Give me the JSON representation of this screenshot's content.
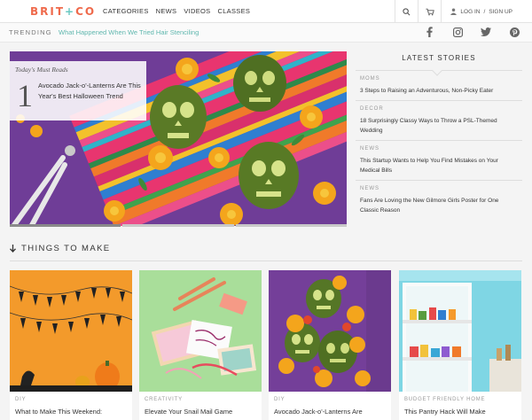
{
  "header": {
    "logo_left": "BRIT",
    "logo_plus": "+",
    "logo_right": "CO",
    "nav": [
      "CATEGORIES",
      "NEWS",
      "VIDEOS",
      "CLASSES"
    ],
    "login": "LOG IN",
    "signup_sep": "/",
    "signup": "SIGN UP"
  },
  "trending": {
    "label": "TRENDING",
    "link": "What Happened When We Tried Hair Stenciling"
  },
  "hero": {
    "tag": "Today's Must Reads",
    "number": "1",
    "title": "Avocado Jack-o'-Lanterns Are This Year's Best Halloween Trend",
    "slides": 3,
    "active_slide": 1
  },
  "latest": {
    "title": "LATEST STORIES",
    "stories": [
      {
        "category": "MOMS",
        "title": "3 Steps to Raising an Adventurous, Non-Picky Eater"
      },
      {
        "category": "DECOR",
        "title": "18 Surprisingly Classy Ways to Throw a PSL-Themed Wedding"
      },
      {
        "category": "NEWS",
        "title": "This Startup Wants to Help You Find Mistakes on Your Medical Bills"
      },
      {
        "category": "NEWS",
        "title": "Fans Are Loving the New Gilmore Girls Poster for One Classic Reason"
      }
    ]
  },
  "section": {
    "title": "THINGS TO MAKE"
  },
  "cards": [
    {
      "category": "DIY",
      "title": "What to Make This Weekend:"
    },
    {
      "category": "CREATIVITY",
      "title": "Elevate Your Snail Mail Game"
    },
    {
      "category": "DIY",
      "title": "Avocado Jack-o'-Lanterns Are"
    },
    {
      "category": "BUDGET FRIENDLY HOME",
      "title": "This Pantry Hack Will Make"
    }
  ],
  "colors": {
    "accent_coral": "#ef6a4c",
    "accent_teal": "#6ac8c2",
    "trending_link": "#5fb7ae"
  }
}
